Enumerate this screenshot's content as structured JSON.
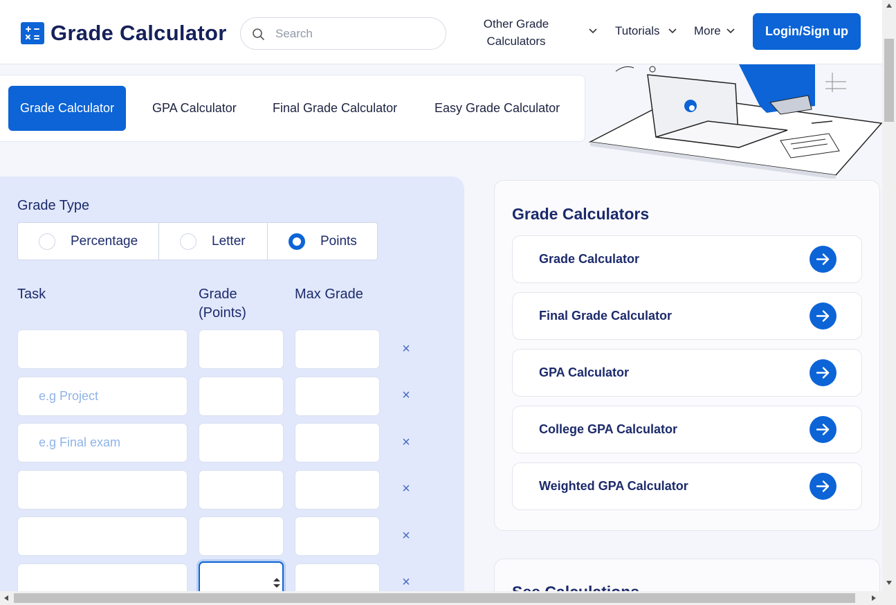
{
  "header": {
    "logo_text": "Grade Calculator",
    "search_placeholder": "Search",
    "nav_other_line1": "Other Grade",
    "nav_other_line2": "Calculators",
    "nav_tutorials": "Tutorials",
    "nav_more": "More",
    "login_label": "Login/Sign up"
  },
  "tabs": [
    {
      "label": "Grade Calculator",
      "active": true
    },
    {
      "label": "GPA Calculator"
    },
    {
      "label": "Final Grade Calculator"
    },
    {
      "label": "Easy Grade Calculator"
    }
  ],
  "form": {
    "grade_type_label": "Grade Type",
    "options": [
      "Percentage",
      "Letter",
      "Points"
    ],
    "selected": "Points",
    "col_task": "Task",
    "col_grade_line1": "Grade",
    "col_grade_line2": "(Points)",
    "col_max": "Max Grade",
    "rows": [
      {
        "task_placeholder": ""
      },
      {
        "task_placeholder": "e.g Project"
      },
      {
        "task_placeholder": "e.g Final exam"
      },
      {
        "task_placeholder": ""
      },
      {
        "task_placeholder": ""
      },
      {
        "task_placeholder": ""
      }
    ],
    "delete_symbol": "×"
  },
  "sidebar": {
    "title": "Grade Calculators",
    "items": [
      "Grade Calculator",
      "Final Grade Calculator",
      "GPA Calculator",
      "College GPA Calculator",
      "Weighted GPA Calculator"
    ],
    "second_card_title": "See Calculations"
  },
  "colors": {
    "primary": "#0c64d6",
    "panel": "#e1e8fb",
    "text": "#1c2a6b"
  }
}
